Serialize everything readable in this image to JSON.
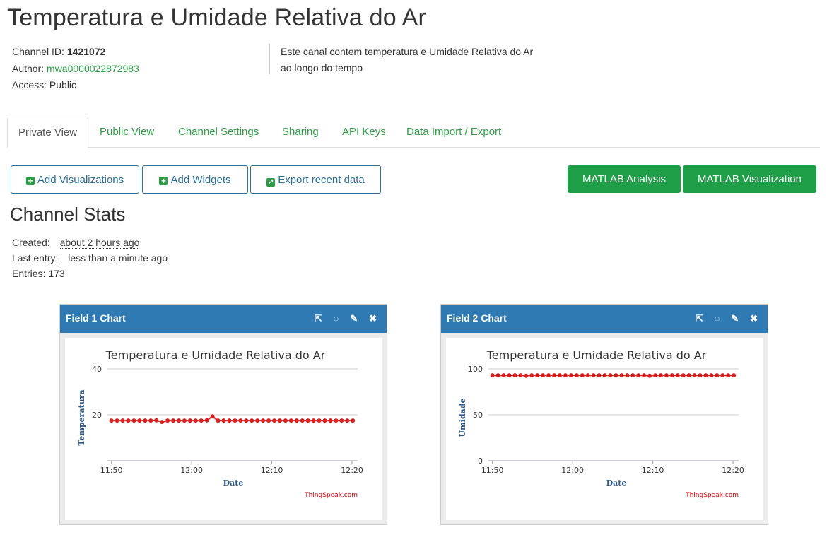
{
  "page_title": "Temperatura e Umidade Relativa do Ar",
  "channel": {
    "id_label": "Channel ID:",
    "id_value": "1421072",
    "author_label": "Author:",
    "author_value": "mwa0000022872983",
    "access_label": "Access:",
    "access_value": "Public",
    "description": "Este canal contem temperatura e Umidade Relativa do Ar ao longo do tempo"
  },
  "tabs": [
    {
      "label": "Private View"
    },
    {
      "label": "Public View"
    },
    {
      "label": "Channel Settings"
    },
    {
      "label": "Sharing"
    },
    {
      "label": "API Keys"
    },
    {
      "label": "Data Import / Export"
    }
  ],
  "buttons": {
    "add_visualizations": "Add Visualizations",
    "add_widgets": "Add Widgets",
    "export_recent": "Export recent data",
    "matlab_analysis": "MATLAB Analysis",
    "matlab_visualization": "MATLAB Visualization"
  },
  "stats": {
    "heading": "Channel Stats",
    "created_label": "Created:",
    "created_value": "about 2 hours ago",
    "last_entry_label": "Last entry:",
    "last_entry_value": "less than a minute ago",
    "entries_label": "Entries:",
    "entries_value": "173"
  },
  "icons": {
    "plus": "plus-square-icon",
    "export": "external-arrow-icon",
    "popout": "external-link-icon",
    "comment": "comment-icon",
    "edit": "pencil-icon",
    "close": "close-icon"
  },
  "colors": {
    "accent": "#2e9c46",
    "header": "#2f7ab3",
    "series": "#d62020"
  },
  "charts": [
    {
      "card_title": "Field 1 Chart",
      "credit": "ThingSpeak.com",
      "chart_data": {
        "type": "line",
        "title": "Temperatura e Umidade Relativa do Ar",
        "xlabel": "Date",
        "ylabel": "Temperatura",
        "x_ticks": [
          "11:50",
          "12:00",
          "12:10",
          "12:20"
        ],
        "y_ticks": [
          "20",
          "40"
        ],
        "ylim": [
          0,
          40
        ],
        "xlim_minutes": [
          -0.5,
          30.7
        ],
        "series": [
          {
            "values": [
              [
                0,
                17.5
              ],
              [
                0.7,
                17.5
              ],
              [
                1.4,
                17.5
              ],
              [
                2.1,
                17.5
              ],
              [
                2.8,
                17.5
              ],
              [
                3.5,
                17.5
              ],
              [
                4.2,
                17.5
              ],
              [
                4.9,
                17.5
              ],
              [
                5.6,
                17.6
              ],
              [
                6.3,
                16.9
              ],
              [
                7.0,
                17.5
              ],
              [
                7.7,
                17.5
              ],
              [
                8.4,
                17.5
              ],
              [
                9.1,
                17.5
              ],
              [
                9.8,
                17.5
              ],
              [
                10.5,
                17.5
              ],
              [
                11.2,
                17.5
              ],
              [
                11.9,
                17.6
              ],
              [
                12.6,
                19.3
              ],
              [
                13.3,
                17.5
              ],
              [
                14.0,
                17.5
              ],
              [
                14.7,
                17.5
              ],
              [
                15.4,
                17.5
              ],
              [
                16.1,
                17.5
              ],
              [
                16.8,
                17.5
              ],
              [
                17.5,
                17.5
              ],
              [
                18.2,
                17.5
              ],
              [
                18.9,
                17.5
              ],
              [
                19.6,
                17.5
              ],
              [
                20.3,
                17.5
              ],
              [
                21.0,
                17.5
              ],
              [
                21.7,
                17.5
              ],
              [
                22.4,
                17.5
              ],
              [
                23.1,
                17.5
              ],
              [
                23.8,
                17.5
              ],
              [
                24.5,
                17.5
              ],
              [
                25.2,
                17.5
              ],
              [
                25.9,
                17.5
              ],
              [
                26.6,
                17.5
              ],
              [
                27.3,
                17.5
              ],
              [
                28.0,
                17.5
              ],
              [
                28.7,
                17.5
              ],
              [
                29.4,
                17.5
              ],
              [
                30.1,
                17.5
              ]
            ]
          }
        ]
      }
    },
    {
      "card_title": "Field 2 Chart",
      "credit": "ThingSpeak.com",
      "chart_data": {
        "type": "line",
        "title": "Temperatura e Umidade Relativa do Ar",
        "xlabel": "Date",
        "ylabel": "Umidade",
        "x_ticks": [
          "11:50",
          "12:00",
          "12:10",
          "12:20"
        ],
        "y_ticks": [
          "0",
          "50",
          "100"
        ],
        "ylim": [
          0,
          100
        ],
        "xlim_minutes": [
          -0.5,
          30.7
        ],
        "series": [
          {
            "values": [
              [
                0,
                93
              ],
              [
                0.7,
                93
              ],
              [
                1.4,
                93
              ],
              [
                2.1,
                93
              ],
              [
                2.8,
                93
              ],
              [
                3.5,
                93
              ],
              [
                4.2,
                92.5
              ],
              [
                4.9,
                93
              ],
              [
                5.6,
                93
              ],
              [
                6.3,
                93
              ],
              [
                7.0,
                93
              ],
              [
                7.7,
                93
              ],
              [
                8.4,
                93
              ],
              [
                9.1,
                93
              ],
              [
                9.8,
                93
              ],
              [
                10.5,
                93
              ],
              [
                11.2,
                93
              ],
              [
                11.9,
                93
              ],
              [
                12.6,
                93
              ],
              [
                13.3,
                93
              ],
              [
                14.0,
                93
              ],
              [
                14.7,
                93
              ],
              [
                15.4,
                93
              ],
              [
                16.1,
                93
              ],
              [
                16.8,
                93
              ],
              [
                17.5,
                93
              ],
              [
                18.2,
                93
              ],
              [
                18.9,
                93
              ],
              [
                19.6,
                92.5
              ],
              [
                20.3,
                93
              ],
              [
                21.0,
                93
              ],
              [
                21.7,
                93
              ],
              [
                22.4,
                93
              ],
              [
                23.1,
                93
              ],
              [
                23.8,
                93
              ],
              [
                24.5,
                93
              ],
              [
                25.2,
                93
              ],
              [
                25.9,
                93
              ],
              [
                26.6,
                93
              ],
              [
                27.3,
                93
              ],
              [
                28.0,
                93
              ],
              [
                28.7,
                93
              ],
              [
                29.4,
                93
              ],
              [
                30.1,
                93
              ]
            ]
          }
        ]
      }
    }
  ]
}
